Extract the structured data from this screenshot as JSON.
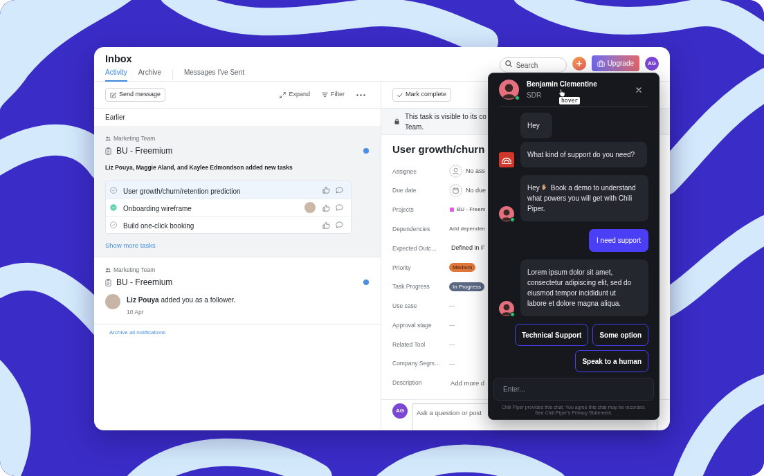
{
  "inbox": {
    "title": "Inbox",
    "tab_groups": [
      [
        {
          "label": "Activity",
          "selected": true
        },
        {
          "label": "Archive",
          "selected": false
        }
      ],
      [
        {
          "label": "Messages I've Sent",
          "selected": false
        }
      ]
    ]
  },
  "header_actions": {
    "search": {
      "placeholder": "Search"
    },
    "upgrade_button": "Upgrade",
    "avatar": "AG"
  },
  "inbox_toolbar": {
    "send_button": "Send message",
    "actions": [
      {
        "kind": "expand",
        "label": "Expand"
      },
      {
        "kind": "filter",
        "label": "Filter"
      }
    ]
  },
  "section_label": "Earlier",
  "notifications": [
    {
      "kind": "tasks",
      "selected": true,
      "team": "Marketing Team",
      "project": "BU - Freemium",
      "unread": true,
      "summary": "Liz Pouya, Maggie Aland, and Kaylee Edmondson added new tasks",
      "tasks": [
        {
          "title": "User growth/churn/retention prediction",
          "selected": true,
          "completed": false,
          "assignee_avatar": false
        },
        {
          "title": "Onboarding wireframe",
          "selected": false,
          "completed": true,
          "assignee_avatar": true
        },
        {
          "title": "Build one-click booking",
          "selected": false,
          "completed": false,
          "assignee_avatar": false
        }
      ],
      "show_more": "Show more tasks"
    },
    {
      "kind": "follower",
      "selected": false,
      "team": "Marketing Team",
      "project": "BU - Freemium",
      "unread": true,
      "message": "**Liz Pouya** added you as a follower.",
      "date": "10 Apr"
    }
  ],
  "archive_all": "Archive all notifications",
  "task_detail": {
    "mark_complete": "Mark complete",
    "visibility_notice": [
      "This task is visible to its co",
      "Team."
    ],
    "title": "User growth/churn",
    "fields": [
      {
        "label": "Assignee",
        "kind": "person",
        "value": "No ass"
      },
      {
        "label": "Due date",
        "kind": "date",
        "value": "No due"
      },
      {
        "label": "Projects",
        "kind": "project",
        "value": "BU - Freem"
      },
      {
        "label": "Dependencies",
        "kind": "action",
        "value": "Add dependen"
      },
      {
        "label": "Expected Outc…",
        "kind": "value",
        "value": "Defined in F"
      },
      {
        "label": "Priority",
        "kind": "pill",
        "value": "Medium",
        "color": "#e0773a"
      },
      {
        "label": "Task Progress",
        "kind": "pill",
        "value": "In Progress",
        "color": "#5b6884"
      },
      {
        "label": "Use case",
        "kind": "empty",
        "value": "—"
      },
      {
        "label": "Approval stage",
        "kind": "empty",
        "value": "—"
      },
      {
        "label": "Related Tool",
        "kind": "empty",
        "value": "—"
      },
      {
        "label": "Company Segm…",
        "kind": "empty",
        "value": "—"
      },
      {
        "label": "Description",
        "kind": "placeholder",
        "value": "Add more d"
      }
    ]
  },
  "comment": {
    "avatar": "AG",
    "placeholder": "Ask a question or post"
  },
  "chat": {
    "agent": {
      "name": "Benjamin Clementine",
      "role": "SDR",
      "online": true
    },
    "tooltip": "hover",
    "messages": [
      {
        "kind": "plain",
        "text": "Hey"
      },
      {
        "kind": "logo",
        "text": "What kind of support do you need?"
      },
      {
        "kind": "avatar",
        "greeting": "Hey",
        "wave": true,
        "text": "Book a demo to understand what powers you will get with Chili Piper."
      },
      {
        "kind": "user",
        "text": "I need support"
      },
      {
        "kind": "avatar",
        "text": "Lorem ipsum dolor sit amet, consectetur adipiscing elit, sed do eiusmod tempor incididunt ut labore et dolore magna aliqua."
      }
    ],
    "quick_replies": [
      "Technical Support",
      "Some option",
      "Speak to a human"
    ],
    "input": {
      "placeholder": "Enter..."
    },
    "disclaimer": "Chili Piper provides this chat. You agree this chat may be recorded. See Chili Piper's Privacy Statement."
  }
}
